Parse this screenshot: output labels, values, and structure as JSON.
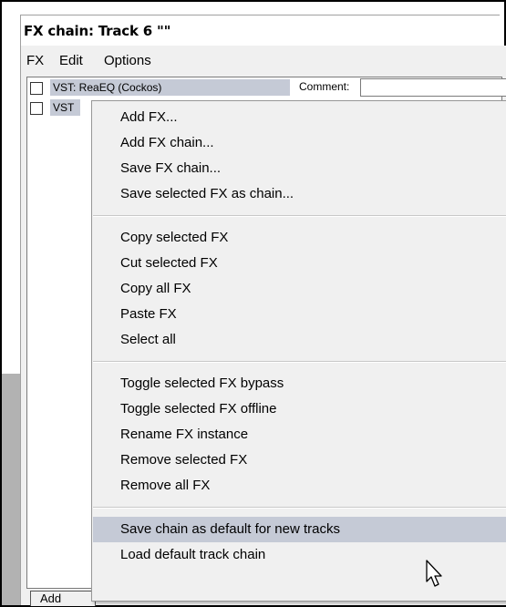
{
  "window": {
    "title": "FX chain: Track 6 \"\""
  },
  "menubar": {
    "fx": "FX",
    "edit": "Edit",
    "options": "Options"
  },
  "fx_list": [
    {
      "name": "VST: ReaEQ (Cockos)"
    },
    {
      "name": "VST"
    }
  ],
  "comment_label": "Comment:",
  "bottom_button": "Add",
  "context_menu": {
    "groups": [
      [
        "Add FX...",
        "Add FX chain...",
        "Save FX chain...",
        "Save selected FX as chain..."
      ],
      [
        "Copy selected FX",
        "Cut selected FX",
        "Copy all FX",
        "Paste FX",
        "Select all"
      ],
      [
        "Toggle selected FX bypass",
        "Toggle selected FX offline",
        "Rename FX instance",
        "Remove selected FX",
        "Remove all FX"
      ],
      [
        "Save chain as default for new tracks",
        "Load default track chain"
      ]
    ],
    "highlighted": "Save chain as default for new tracks"
  },
  "colors": {
    "highlight": "#c5cad6",
    "menu_bg": "#f0f0f0"
  }
}
